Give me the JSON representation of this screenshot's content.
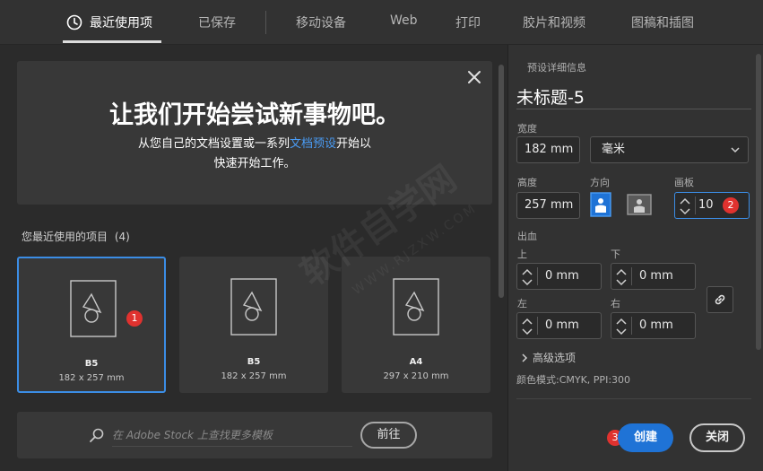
{
  "tabs": [
    {
      "label": "最近使用项",
      "active": true
    },
    {
      "label": "已保存"
    },
    {
      "label": "移动设备"
    },
    {
      "label": "Web"
    },
    {
      "label": "打印"
    },
    {
      "label": "胶片和视频"
    },
    {
      "label": "图稿和插图"
    }
  ],
  "hero": {
    "title": "让我们开始尝试新事物吧。",
    "sub_pre": "从您自己的文档设置或一系列",
    "sub_link": "文档预设",
    "sub_post": "开始以",
    "sub_line2": "快速开始工作。"
  },
  "recent": {
    "heading": "您最近使用的项目",
    "count": "(4)",
    "items": [
      {
        "name": "B5",
        "dims": "182 x 257 mm",
        "selected": true
      },
      {
        "name": "B5",
        "dims": "182 x 257 mm"
      },
      {
        "name": "A4",
        "dims": "297 x 210 mm"
      }
    ]
  },
  "search": {
    "placeholder": "在 Adobe Stock 上查找更多模板",
    "go_label": "前往"
  },
  "preset": {
    "section_title": "预设详细信息",
    "doc_name": "未标题-5",
    "width_label": "宽度",
    "width_value": "182 mm",
    "unit_value": "毫米",
    "height_label": "高度",
    "height_value": "257 mm",
    "orientation_label": "方向",
    "artboards_label": "画板",
    "artboards_value": "10",
    "bleed_label": "出血",
    "bleed_top_label": "上",
    "bleed_top_value": "0 mm",
    "bleed_bottom_label": "下",
    "bleed_bottom_value": "0 mm",
    "bleed_left_label": "左",
    "bleed_left_value": "0 mm",
    "bleed_right_label": "右",
    "bleed_right_value": "0 mm",
    "advanced_label": "高级选项",
    "color_mode": "颜色模式:CMYK, PPI:300",
    "create_label": "创建",
    "close_label": "关闭"
  },
  "annotations": {
    "b1": "1",
    "b2": "2",
    "b3": "3"
  },
  "watermark": {
    "main": "软件自学网",
    "sub": "WWW.RJZXW.COM"
  },
  "colors": {
    "accent": "#1f73d6",
    "selection": "#3b8de5",
    "badge": "#e0322f",
    "link": "#4a9cf5"
  }
}
